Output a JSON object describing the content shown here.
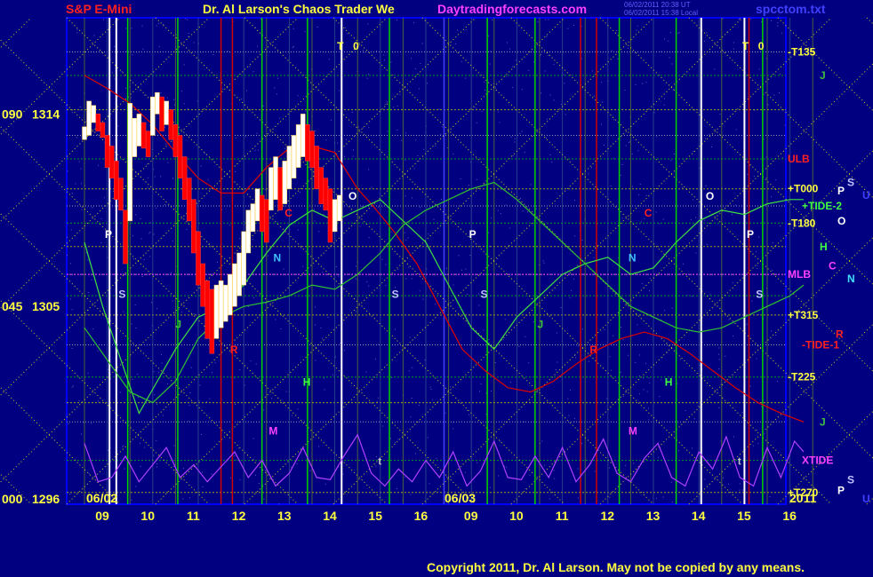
{
  "header": {
    "symbol": "S&P E-Mini",
    "title": "Dr. Al Larson's Chaos Trader We",
    "site": "Daytradingforecasts.com",
    "stamp_1": "06/02/2011 20:38 UT",
    "stamp_2": "06/02/2011 15:38 Local",
    "file": "spcctom.txt"
  },
  "footer": {
    "copyright": "Copyright 2011, Dr. Al Larson. May not be copied by any means."
  },
  "colors": {
    "background": "#000080",
    "frame": "#0000ff",
    "grid_yellow": "#c8c800",
    "grid_green": "#00c000",
    "price_up": "#ffffff",
    "price_down": "#ff0000",
    "ulb": "#e00000",
    "tide": "#40e040",
    "xtide": "#c040ff"
  },
  "chart_data": {
    "type": "line",
    "title": "S&P E-Mini",
    "y_tick_labels": [
      {
        "value": 1314,
        "label": "1314",
        "prefix": "090"
      },
      {
        "value": 1305,
        "label": "1305",
        "prefix": "045"
      },
      {
        "value": 1296,
        "label": "1296",
        "prefix": "000"
      }
    ],
    "ylim": [
      1296,
      1318.5
    ],
    "x_hours": [
      "09",
      "10",
      "11",
      "12",
      "13",
      "14",
      "15",
      "16",
      "09",
      "10",
      "11",
      "12",
      "13",
      "14",
      "15",
      "16"
    ],
    "dates": [
      "06/02",
      "06/03"
    ],
    "year": "2011",
    "right_labels": [
      {
        "text": "-T135",
        "color": "#ffff40",
        "value": 1316.9
      },
      {
        "text": "J",
        "color": "#40c040",
        "value": 1315.8
      },
      {
        "text": "ULB",
        "color": "#ff2020",
        "value": 1311.9
      },
      {
        "text": "+T000",
        "color": "#ffff40",
        "value": 1310.5
      },
      {
        "text": "+TIDE-2",
        "color": "#40ff40",
        "value": 1309.7
      },
      {
        "text": "-T180",
        "color": "#ffff40",
        "value": 1308.9
      },
      {
        "text": "H",
        "color": "#40ff40",
        "value": 1307.8
      },
      {
        "text": "C",
        "color": "#ff40ff",
        "value": 1306.9
      },
      {
        "text": "MLB",
        "color": "#ff40ff",
        "value": 1306.5
      },
      {
        "text": "+T315",
        "color": "#ffff40",
        "value": 1304.6
      },
      {
        "text": "R",
        "color": "#ff2020",
        "value": 1303.7
      },
      {
        "text": "-TIDE-1",
        "color": "#ff2020",
        "value": 1303.2
      },
      {
        "text": "-T225",
        "color": "#ffff40",
        "value": 1301.7
      },
      {
        "text": "J",
        "color": "#40c040",
        "value": 1299.6
      },
      {
        "text": "XTIDE",
        "color": "#ff40ff",
        "value": 1297.8
      },
      {
        "text": "+T270",
        "color": "#ffff40",
        "value": 1296.3
      }
    ],
    "bars": [
      [
        0.0,
        1312.8,
        1313.4
      ],
      [
        0.1,
        1313.0,
        1314.6
      ],
      [
        0.2,
        1313.6,
        1314.4
      ],
      [
        0.3,
        1313.2,
        1314.0
      ],
      [
        0.4,
        1312.9,
        1313.6
      ],
      [
        0.5,
        1311.5,
        1313.0
      ],
      [
        0.6,
        1311.0,
        1312.5
      ],
      [
        0.7,
        1310.0,
        1311.8
      ],
      [
        0.8,
        1309.5,
        1311.0
      ],
      [
        0.9,
        1307.0,
        1309.5
      ],
      [
        1.0,
        1309.0,
        1314.5
      ],
      [
        1.1,
        1312.0,
        1313.8
      ],
      [
        1.2,
        1312.5,
        1314.0
      ],
      [
        1.3,
        1312.4,
        1313.6
      ],
      [
        1.4,
        1312.0,
        1313.2
      ],
      [
        1.5,
        1313.0,
        1314.8
      ],
      [
        1.6,
        1314.0,
        1315.0
      ],
      [
        1.7,
        1313.2,
        1314.8
      ],
      [
        1.8,
        1313.5,
        1314.6
      ],
      [
        1.9,
        1312.8,
        1314.2
      ],
      [
        2.0,
        1312.0,
        1313.5
      ],
      [
        2.1,
        1311.0,
        1313.0
      ],
      [
        2.2,
        1310.0,
        1312.0
      ],
      [
        2.3,
        1309.0,
        1311.0
      ],
      [
        2.4,
        1307.5,
        1310.0
      ],
      [
        2.5,
        1306.0,
        1308.5
      ],
      [
        2.6,
        1305.0,
        1307.0
      ],
      [
        2.7,
        1303.5,
        1306.2
      ],
      [
        2.8,
        1302.8,
        1305.8
      ],
      [
        2.9,
        1303.5,
        1306.0
      ],
      [
        3.0,
        1304.0,
        1306.2
      ],
      [
        3.1,
        1304.3,
        1306.0
      ],
      [
        3.2,
        1304.6,
        1306.5
      ],
      [
        3.3,
        1305.0,
        1307.0
      ],
      [
        3.4,
        1305.5,
        1307.5
      ],
      [
        3.5,
        1306.0,
        1308.5
      ],
      [
        3.6,
        1307.5,
        1309.5
      ],
      [
        3.7,
        1308.5,
        1309.8
      ],
      [
        3.8,
        1309.0,
        1310.5
      ],
      [
        3.9,
        1308.5,
        1310.2
      ],
      [
        4.0,
        1308.0,
        1310.0
      ],
      [
        4.1,
        1309.5,
        1311.5
      ],
      [
        4.2,
        1310.0,
        1312.0
      ],
      [
        4.3,
        1309.5,
        1311.5
      ],
      [
        4.4,
        1309.8,
        1311.8
      ],
      [
        4.5,
        1310.5,
        1312.5
      ],
      [
        4.6,
        1311.0,
        1313.0
      ],
      [
        4.7,
        1311.5,
        1313.5
      ],
      [
        4.8,
        1312.0,
        1314.0
      ],
      [
        4.9,
        1311.8,
        1313.5
      ],
      [
        5.0,
        1311.5,
        1313.2
      ],
      [
        5.1,
        1310.5,
        1312.5
      ],
      [
        5.2,
        1309.8,
        1311.5
      ],
      [
        5.3,
        1309.5,
        1311.0
      ],
      [
        5.4,
        1308.0,
        1310.5
      ],
      [
        5.5,
        1308.5,
        1310.0
      ],
      [
        5.6,
        1309.0,
        1310.2
      ]
    ],
    "series": [
      {
        "name": "ULB",
        "color": "#e00000",
        "x": [
          0,
          0.5,
          1.0,
          1.5,
          2.0,
          2.5,
          3.0,
          3.5,
          4.0,
          4.5,
          5.0,
          5.5,
          6.0,
          6.3,
          6.8,
          7.3,
          7.8,
          8.3,
          8.8,
          9.3,
          9.8,
          10.3,
          10.8,
          11.3,
          11.8,
          12.3,
          12.8,
          13.3,
          13.8,
          14.3,
          14.8,
          15.3,
          15.8
        ],
        "y": [
          1315.8,
          1315.2,
          1314.5,
          1313.5,
          1312.2,
          1311.0,
          1310.3,
          1310.3,
          1311.5,
          1312.4,
          1312.5,
          1312.2,
          1310.5,
          1309.8,
          1308.5,
          1307.0,
          1305.0,
          1303.0,
          1302.0,
          1301.2,
          1301.0,
          1301.5,
          1302.3,
          1303.0,
          1303.5,
          1303.8,
          1303.5,
          1302.8,
          1302.0,
          1301.2,
          1300.5,
          1300.0,
          1299.6
        ]
      },
      {
        "name": "TIDE",
        "color": "#40e040",
        "x": [
          0,
          0.4,
          0.8,
          1.2,
          1.6,
          2.0,
          2.5,
          3.0,
          3.5,
          4.0,
          4.5,
          5.0,
          5.5,
          6.0,
          6.5,
          7.0,
          7.5,
          8.0,
          8.5,
          9.0,
          9.5,
          10.0,
          10.5,
          11.0,
          11.5,
          12.0,
          12.5,
          13.0,
          13.5,
          14.0,
          14.5,
          15.0,
          15.5,
          15.8
        ],
        "y": [
          1308.0,
          1305.0,
          1302.5,
          1300.0,
          1301.5,
          1303.0,
          1304.5,
          1305.0,
          1306.0,
          1307.5,
          1308.8,
          1309.5,
          1309.0,
          1309.5,
          1310.0,
          1309.0,
          1308.0,
          1306.0,
          1304.0,
          1303.0,
          1304.5,
          1305.5,
          1306.5,
          1307.0,
          1307.3,
          1306.5,
          1306.8,
          1308.0,
          1309.0,
          1309.5,
          1309.3,
          1309.8,
          1310.0,
          1310.0
        ]
      },
      {
        "name": "GREEN2",
        "color": "#30c030",
        "x": [
          0,
          0.5,
          1.0,
          1.5,
          2.0,
          2.5,
          3.0,
          3.5,
          4.0,
          4.5,
          5.0,
          5.5,
          6.0,
          6.5,
          7.0,
          7.5,
          8.0,
          8.5,
          9.0,
          9.5,
          10.0,
          10.5,
          11.0,
          11.5,
          12.0,
          12.5,
          13.0,
          13.5,
          14.0,
          14.5,
          15.0,
          15.5,
          15.8
        ],
        "y": [
          1304.0,
          1302.5,
          1301.0,
          1300.5,
          1301.5,
          1303.5,
          1304.5,
          1305.0,
          1305.2,
          1305.5,
          1306.0,
          1305.8,
          1306.5,
          1307.5,
          1308.8,
          1309.5,
          1310.0,
          1310.5,
          1310.8,
          1310.0,
          1309.0,
          1308.0,
          1307.0,
          1306.0,
          1305.0,
          1304.5,
          1304.0,
          1303.8,
          1304.0,
          1304.5,
          1305.0,
          1305.5,
          1306.0
        ]
      },
      {
        "name": "XTIDE",
        "color": "#b040ff",
        "x": [
          0,
          0.3,
          0.6,
          0.9,
          1.2,
          1.5,
          1.8,
          2.1,
          2.4,
          2.7,
          3.0,
          3.3,
          3.6,
          3.9,
          4.2,
          4.5,
          4.8,
          5.1,
          5.4,
          5.7,
          6.0,
          6.3,
          6.6,
          6.9,
          7.2,
          7.5,
          7.8,
          8.1,
          8.4,
          8.7,
          9.0,
          9.3,
          9.6,
          9.9,
          10.2,
          10.5,
          10.8,
          11.1,
          11.4,
          11.7,
          12.0,
          12.3,
          12.6,
          12.9,
          13.2,
          13.5,
          13.8,
          14.1,
          14.4,
          14.7,
          15.0,
          15.3,
          15.6,
          15.8
        ],
        "y": [
          1298.6,
          1296.8,
          1297.0,
          1298.0,
          1296.8,
          1297.6,
          1298.4,
          1297.0,
          1297.6,
          1296.8,
          1297.5,
          1298.2,
          1297.0,
          1297.8,
          1296.6,
          1297.2,
          1298.4,
          1297.0,
          1296.9,
          1298.0,
          1299.0,
          1297.2,
          1296.6,
          1297.4,
          1296.8,
          1297.8,
          1297.0,
          1298.2,
          1296.6,
          1297.3,
          1298.7,
          1297.0,
          1296.9,
          1298.0,
          1297.0,
          1298.4,
          1296.8,
          1297.6,
          1298.8,
          1297.2,
          1296.8,
          1297.9,
          1298.6,
          1297.0,
          1296.6,
          1298.2,
          1297.4,
          1298.9,
          1297.0,
          1296.6,
          1298.4,
          1297.0,
          1298.7,
          1298.2
        ]
      }
    ],
    "chart_markers": [
      {
        "text": "T",
        "x": 5.55,
        "y": 1317.0,
        "color": "#ffff40"
      },
      {
        "text": "0",
        "x": 5.9,
        "y": 1317.0,
        "color": "#ffff40"
      },
      {
        "text": "T",
        "x": 14.45,
        "y": 1317.0,
        "color": "#ffff40"
      },
      {
        "text": "0",
        "x": 14.8,
        "y": 1317.0,
        "color": "#ffff40"
      },
      {
        "text": "O",
        "x": 5.8,
        "y": 1310.0,
        "color": "#ffffff"
      },
      {
        "text": "O",
        "x": 13.65,
        "y": 1310.0,
        "color": "#ffffff"
      },
      {
        "text": "P",
        "x": 0.45,
        "y": 1308.2,
        "color": "#ffffff"
      },
      {
        "text": "P",
        "x": 8.45,
        "y": 1308.2,
        "color": "#ffffff"
      },
      {
        "text": "P",
        "x": 14.55,
        "y": 1308.2,
        "color": "#ffffff"
      },
      {
        "text": "S",
        "x": 0.75,
        "y": 1305.4,
        "color": "#c0c0ff"
      },
      {
        "text": "S",
        "x": 6.75,
        "y": 1305.4,
        "color": "#c0c0ff"
      },
      {
        "text": "S",
        "x": 8.7,
        "y": 1305.4,
        "color": "#c0c0ff"
      },
      {
        "text": "S",
        "x": 14.75,
        "y": 1305.4,
        "color": "#c0c0ff"
      },
      {
        "text": "C",
        "x": 4.4,
        "y": 1309.2,
        "color": "#ff2020"
      },
      {
        "text": "C",
        "x": 12.3,
        "y": 1309.2,
        "color": "#ff2020"
      },
      {
        "text": "N",
        "x": 4.15,
        "y": 1307.1,
        "color": "#40c0ff"
      },
      {
        "text": "N",
        "x": 11.95,
        "y": 1307.1,
        "color": "#40c0ff"
      },
      {
        "text": "R",
        "x": 3.2,
        "y": 1302.8,
        "color": "#ff2020"
      },
      {
        "text": "R",
        "x": 11.1,
        "y": 1302.8,
        "color": "#ff2020"
      },
      {
        "text": "H",
        "x": 4.8,
        "y": 1301.3,
        "color": "#40ff40"
      },
      {
        "text": "H",
        "x": 12.75,
        "y": 1301.3,
        "color": "#40ff40"
      },
      {
        "text": "J",
        "x": 2.0,
        "y": 1304.0,
        "color": "#40c040"
      },
      {
        "text": "J",
        "x": 9.95,
        "y": 1304.0,
        "color": "#40c040"
      },
      {
        "text": "M",
        "x": 4.05,
        "y": 1299.0,
        "color": "#ff40ff"
      },
      {
        "text": "M",
        "x": 11.95,
        "y": 1299.0,
        "color": "#ff40ff"
      },
      {
        "text": "t",
        "x": 6.45,
        "y": 1297.6,
        "color": "#c0c0c0"
      },
      {
        "text": "t",
        "x": 14.35,
        "y": 1297.6,
        "color": "#c0c0c0"
      }
    ],
    "right_glyphs": [
      {
        "text": "S",
        "color": "#c0c0ff",
        "value": 1310.8,
        "col": 2
      },
      {
        "text": "P",
        "color": "#ffffff",
        "value": 1310.4,
        "col": 1
      },
      {
        "text": "U",
        "color": "#4040ff",
        "value": 1310.2,
        "col": 3
      },
      {
        "text": "O",
        "color": "#ffffff",
        "value": 1309.0,
        "col": 1
      },
      {
        "text": "N",
        "color": "#40e0ff",
        "value": 1306.3,
        "col": 2
      },
      {
        "text": "S",
        "color": "#c0c0ff",
        "value": 1296.9,
        "col": 2
      },
      {
        "text": "P",
        "color": "#ffffff",
        "value": 1296.4,
        "col": 1
      },
      {
        "text": "U",
        "color": "#4040ff",
        "value": 1296.0,
        "col": 3
      }
    ],
    "session_vlines_white": [
      0.55,
      0.7,
      5.65,
      13.55,
      14.5
    ],
    "session_vlines_red": [
      3.0,
      3.25,
      10.9,
      11.25,
      14.6
    ],
    "session_vlines_green": [
      0.95,
      2.05,
      3.9,
      4.9,
      6.7,
      8.85,
      9.9,
      11.75,
      13.0,
      14.9
    ],
    "grid": "on"
  }
}
